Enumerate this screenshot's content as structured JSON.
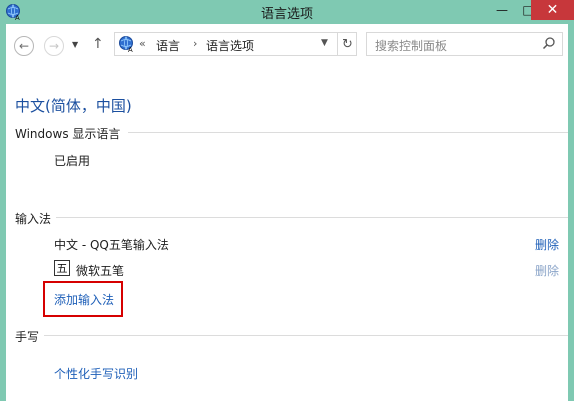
{
  "window": {
    "title": "语言选项",
    "minimize": "—",
    "maximize": "□",
    "close": "✕"
  },
  "toolbar": {
    "back": "←",
    "forward": "→",
    "recent_dropdown": "▼",
    "up": "↑",
    "breadcrumb": {
      "prefix": "«",
      "items": [
        "语言",
        "语言选项"
      ],
      "separator": "›"
    },
    "address_dropdown": "▼",
    "refresh": "↻",
    "search": {
      "placeholder": "搜索控制面板"
    }
  },
  "page": {
    "title": "中文(简体，中国)",
    "display_language": {
      "heading": "Windows 显示语言",
      "status": "已启用"
    },
    "input_methods": {
      "heading": "输入法",
      "items": [
        {
          "name": "中文 - QQ五笔输入法",
          "action": "删除",
          "enabled": true
        },
        {
          "badge": "五",
          "name": "微软五笔",
          "action": "删除",
          "enabled": false
        }
      ],
      "add_link": "添加输入法"
    },
    "handwriting": {
      "heading": "手写",
      "link": "个性化手写识别"
    }
  },
  "colors": {
    "title_bar": "#7fc9b2",
    "link": "#1e5fb8",
    "heading_blue": "#1b4f9f",
    "close_button": "#c7373b",
    "highlight": "#d60000"
  }
}
